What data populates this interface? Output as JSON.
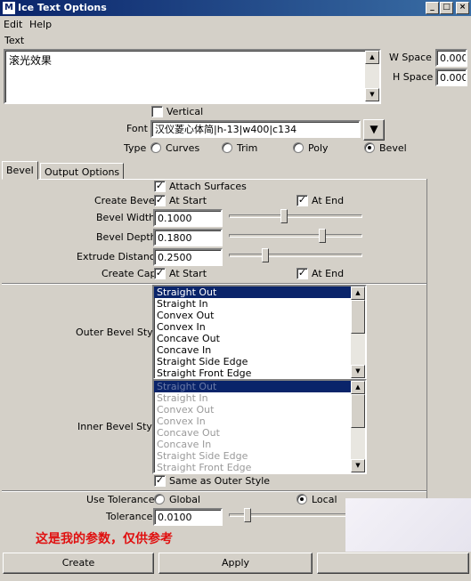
{
  "window": {
    "title": "Ice Text Options",
    "icon": "maya-icon",
    "min": "_",
    "max": "□",
    "close": "×"
  },
  "menu": {
    "edit": "Edit",
    "help": "Help"
  },
  "text_section": {
    "label": "Text",
    "value": "滚光效果"
  },
  "w_space": {
    "label": "W Space",
    "value": "0.000"
  },
  "h_space": {
    "label": "H Space",
    "value": "0.000"
  },
  "vertical": {
    "label": "Vertical",
    "checked": false
  },
  "font": {
    "label": "Font",
    "value": "汉仪菱心体简|h-13|w400|c134"
  },
  "type": {
    "label": "Type",
    "options": [
      "Curves",
      "Trim",
      "Poly",
      "Bevel"
    ],
    "selected": "Bevel"
  },
  "tabs": [
    "Bevel",
    "Output Options"
  ],
  "bevel": {
    "attach_surfaces": "Attach Surfaces",
    "create_bevel": {
      "label": "Create Bevel",
      "at_start": "At Start",
      "at_end": "At End"
    },
    "bevel_width": {
      "label": "Bevel Width",
      "value": "0.1000"
    },
    "bevel_depth": {
      "label": "Bevel Depth",
      "value": "0.1800"
    },
    "extrude_distance": {
      "label": "Extrude Distance",
      "value": "0.2500"
    },
    "create_cap": {
      "label": "Create Cap",
      "at_start": "At Start",
      "at_end": "At End"
    },
    "outer_style": {
      "label": "Outer Bevel Style",
      "items": [
        "Straight Out",
        "Straight In",
        "Convex Out",
        "Convex In",
        "Concave Out",
        "Concave In",
        "Straight Side Edge",
        "Straight Front Edge"
      ],
      "selected": "Straight Out"
    },
    "inner_style": {
      "label": "Inner Bevel Style",
      "items": [
        "Straight Out",
        "Straight In",
        "Convex Out",
        "Convex In",
        "Concave Out",
        "Concave In",
        "Straight Side Edge",
        "Straight Front Edge"
      ],
      "selected": "Straight Out"
    },
    "same_as_outer": "Same as Outer Style",
    "use_tolerance": {
      "label": "Use Tolerance",
      "global": "Global",
      "local": "Local",
      "selected": "Local"
    },
    "tolerance": {
      "label": "Tolerance",
      "value": "0.0100"
    }
  },
  "annotation": "这是我的参数，仅供参考",
  "buttons": {
    "create": "Create",
    "apply": "Apply"
  },
  "colors": {
    "titlebar": "#0a246a",
    "selection": "#0a246a",
    "annotation": "#e01010"
  },
  "slider_levels": {
    "bevel_width": 0.41,
    "bevel_depth": 0.71,
    "extrude_distance": 0.26,
    "tolerance": 0.12
  }
}
